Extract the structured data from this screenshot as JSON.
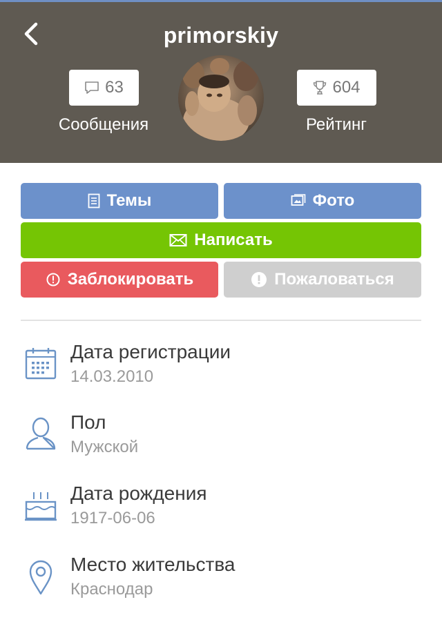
{
  "header": {
    "username": "primorskiy",
    "messages": {
      "count": "63",
      "label": "Сообщения"
    },
    "rating": {
      "count": "604",
      "label": "Рейтинг"
    }
  },
  "actions": {
    "topics": "Темы",
    "photo": "Фото",
    "write": "Написать",
    "block": "Заблокировать",
    "report": "Пожаловаться"
  },
  "info": [
    {
      "label": "Дата регистрации",
      "value": "14.03.2010",
      "icon": "calendar-icon"
    },
    {
      "label": "Пол",
      "value": "Мужской",
      "icon": "user-icon"
    },
    {
      "label": "Дата рождения",
      "value": "1917-06-06",
      "icon": "cake-icon"
    },
    {
      "label": "Место жительства",
      "value": "Краснодар",
      "icon": "location-pin-icon"
    }
  ],
  "colors": {
    "header_bg": "#5f5a52",
    "blue_button": "#6c91cb",
    "green_button": "#75c504",
    "red_button": "#e95a5e",
    "disabled_button": "#cfcfcf",
    "icon_blue": "#6a93c6"
  }
}
